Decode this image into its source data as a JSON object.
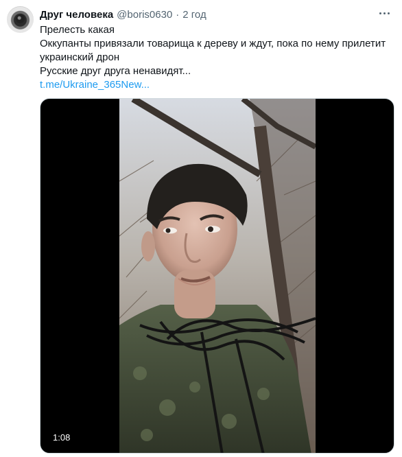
{
  "tweet": {
    "author_name": "Друг человека",
    "author_handle": "@boris0630",
    "separator": "·",
    "time": "2 год",
    "lines": [
      "Прелесть какая",
      "Оккупанты привязали товарища к дереву и ждут, пока по нему прилетит украинский дрон",
      "Русские друг друга ненавидят..."
    ],
    "link": "t.me/Ukraine_365New..."
  },
  "media": {
    "type": "video",
    "duration": "1:08"
  },
  "icons": {
    "avatar": "owl-avatar",
    "more": "more-horizontal-icon"
  }
}
